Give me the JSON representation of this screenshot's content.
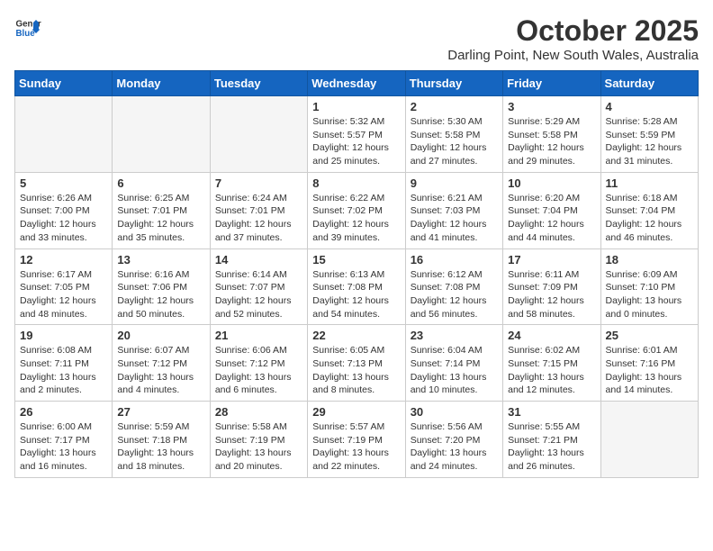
{
  "logo": {
    "general": "General",
    "blue": "Blue"
  },
  "title": "October 2025",
  "location": "Darling Point, New South Wales, Australia",
  "weekdays": [
    "Sunday",
    "Monday",
    "Tuesday",
    "Wednesday",
    "Thursday",
    "Friday",
    "Saturday"
  ],
  "weeks": [
    [
      {
        "day": "",
        "info": ""
      },
      {
        "day": "",
        "info": ""
      },
      {
        "day": "",
        "info": ""
      },
      {
        "day": "1",
        "info": "Sunrise: 5:32 AM\nSunset: 5:57 PM\nDaylight: 12 hours\nand 25 minutes."
      },
      {
        "day": "2",
        "info": "Sunrise: 5:30 AM\nSunset: 5:58 PM\nDaylight: 12 hours\nand 27 minutes."
      },
      {
        "day": "3",
        "info": "Sunrise: 5:29 AM\nSunset: 5:58 PM\nDaylight: 12 hours\nand 29 minutes."
      },
      {
        "day": "4",
        "info": "Sunrise: 5:28 AM\nSunset: 5:59 PM\nDaylight: 12 hours\nand 31 minutes."
      }
    ],
    [
      {
        "day": "5",
        "info": "Sunrise: 6:26 AM\nSunset: 7:00 PM\nDaylight: 12 hours\nand 33 minutes."
      },
      {
        "day": "6",
        "info": "Sunrise: 6:25 AM\nSunset: 7:01 PM\nDaylight: 12 hours\nand 35 minutes."
      },
      {
        "day": "7",
        "info": "Sunrise: 6:24 AM\nSunset: 7:01 PM\nDaylight: 12 hours\nand 37 minutes."
      },
      {
        "day": "8",
        "info": "Sunrise: 6:22 AM\nSunset: 7:02 PM\nDaylight: 12 hours\nand 39 minutes."
      },
      {
        "day": "9",
        "info": "Sunrise: 6:21 AM\nSunset: 7:03 PM\nDaylight: 12 hours\nand 41 minutes."
      },
      {
        "day": "10",
        "info": "Sunrise: 6:20 AM\nSunset: 7:04 PM\nDaylight: 12 hours\nand 44 minutes."
      },
      {
        "day": "11",
        "info": "Sunrise: 6:18 AM\nSunset: 7:04 PM\nDaylight: 12 hours\nand 46 minutes."
      }
    ],
    [
      {
        "day": "12",
        "info": "Sunrise: 6:17 AM\nSunset: 7:05 PM\nDaylight: 12 hours\nand 48 minutes."
      },
      {
        "day": "13",
        "info": "Sunrise: 6:16 AM\nSunset: 7:06 PM\nDaylight: 12 hours\nand 50 minutes."
      },
      {
        "day": "14",
        "info": "Sunrise: 6:14 AM\nSunset: 7:07 PM\nDaylight: 12 hours\nand 52 minutes."
      },
      {
        "day": "15",
        "info": "Sunrise: 6:13 AM\nSunset: 7:08 PM\nDaylight: 12 hours\nand 54 minutes."
      },
      {
        "day": "16",
        "info": "Sunrise: 6:12 AM\nSunset: 7:08 PM\nDaylight: 12 hours\nand 56 minutes."
      },
      {
        "day": "17",
        "info": "Sunrise: 6:11 AM\nSunset: 7:09 PM\nDaylight: 12 hours\nand 58 minutes."
      },
      {
        "day": "18",
        "info": "Sunrise: 6:09 AM\nSunset: 7:10 PM\nDaylight: 13 hours\nand 0 minutes."
      }
    ],
    [
      {
        "day": "19",
        "info": "Sunrise: 6:08 AM\nSunset: 7:11 PM\nDaylight: 13 hours\nand 2 minutes."
      },
      {
        "day": "20",
        "info": "Sunrise: 6:07 AM\nSunset: 7:12 PM\nDaylight: 13 hours\nand 4 minutes."
      },
      {
        "day": "21",
        "info": "Sunrise: 6:06 AM\nSunset: 7:12 PM\nDaylight: 13 hours\nand 6 minutes."
      },
      {
        "day": "22",
        "info": "Sunrise: 6:05 AM\nSunset: 7:13 PM\nDaylight: 13 hours\nand 8 minutes."
      },
      {
        "day": "23",
        "info": "Sunrise: 6:04 AM\nSunset: 7:14 PM\nDaylight: 13 hours\nand 10 minutes."
      },
      {
        "day": "24",
        "info": "Sunrise: 6:02 AM\nSunset: 7:15 PM\nDaylight: 13 hours\nand 12 minutes."
      },
      {
        "day": "25",
        "info": "Sunrise: 6:01 AM\nSunset: 7:16 PM\nDaylight: 13 hours\nand 14 minutes."
      }
    ],
    [
      {
        "day": "26",
        "info": "Sunrise: 6:00 AM\nSunset: 7:17 PM\nDaylight: 13 hours\nand 16 minutes."
      },
      {
        "day": "27",
        "info": "Sunrise: 5:59 AM\nSunset: 7:18 PM\nDaylight: 13 hours\nand 18 minutes."
      },
      {
        "day": "28",
        "info": "Sunrise: 5:58 AM\nSunset: 7:19 PM\nDaylight: 13 hours\nand 20 minutes."
      },
      {
        "day": "29",
        "info": "Sunrise: 5:57 AM\nSunset: 7:19 PM\nDaylight: 13 hours\nand 22 minutes."
      },
      {
        "day": "30",
        "info": "Sunrise: 5:56 AM\nSunset: 7:20 PM\nDaylight: 13 hours\nand 24 minutes."
      },
      {
        "day": "31",
        "info": "Sunrise: 5:55 AM\nSunset: 7:21 PM\nDaylight: 13 hours\nand 26 minutes."
      },
      {
        "day": "",
        "info": ""
      }
    ]
  ]
}
